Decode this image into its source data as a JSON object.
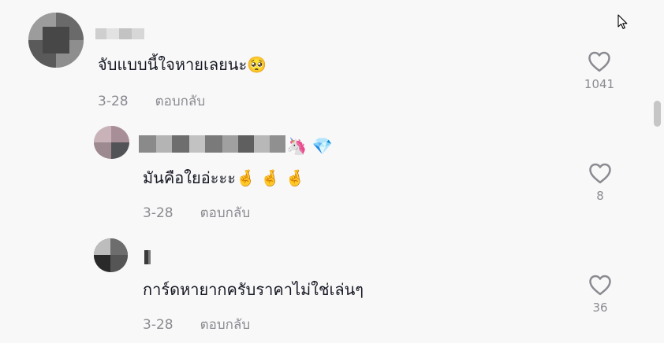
{
  "comments": [
    {
      "text": "จับแบบนี้ใจหายเลยนะ🥺",
      "date": "3-28",
      "reply_label": "ตอบกลับ",
      "likes": "1041"
    },
    {
      "badges": "🦄 💎",
      "text": "มันคือใยอ่ะะะ🤞 🤞 🤞",
      "date": "3-28",
      "reply_label": "ตอบกลับ",
      "likes": "8"
    },
    {
      "text": "การ์ดหายากครับราคาไม่ใช่เล่นๆ",
      "date": "3-28",
      "reply_label": "ตอบกลับ",
      "likes": "36"
    }
  ],
  "colors": {
    "text": "#161823",
    "meta": "#8a8b91",
    "background": "#f8f8f8"
  },
  "icons": {
    "like": "heart-outline-icon",
    "cursor": "mouse-pointer-icon"
  }
}
